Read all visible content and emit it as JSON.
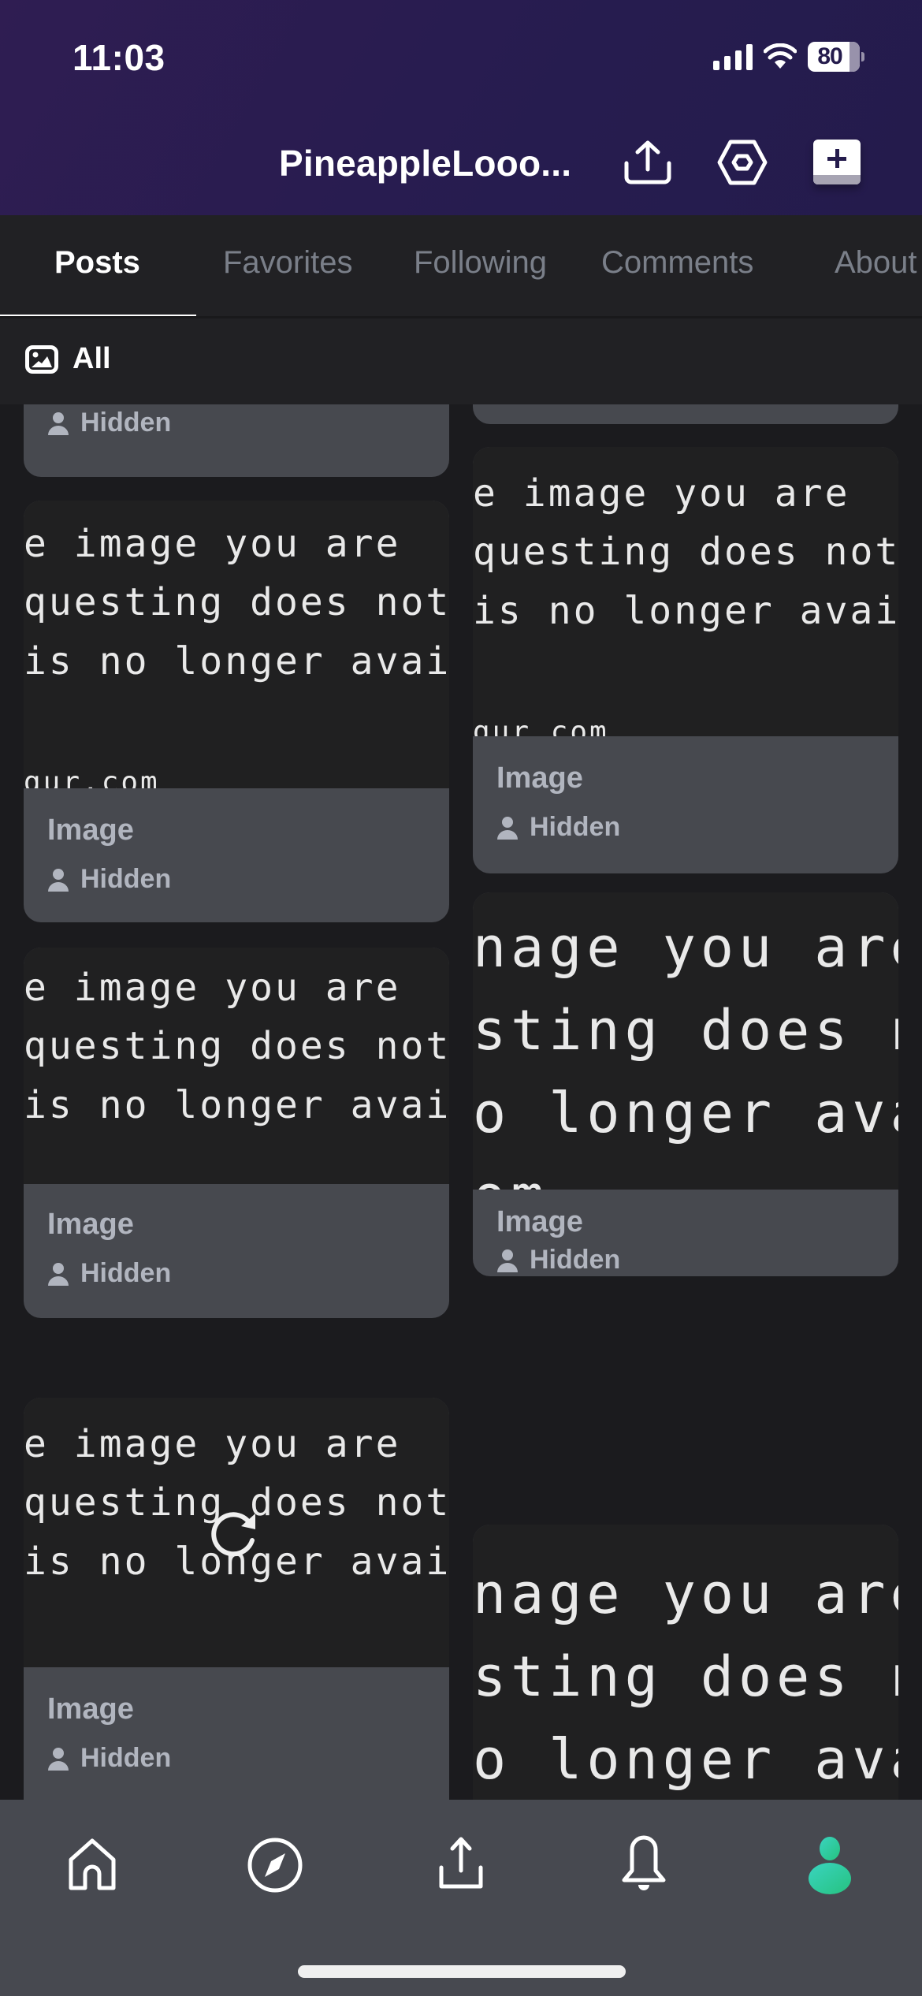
{
  "status_bar": {
    "time": "11:03",
    "battery_percent": "80",
    "signal_icon": "cellular-signal-icon",
    "wifi_icon": "wifi-icon"
  },
  "header": {
    "title": "PineappleLooo...",
    "actions": [
      {
        "name": "share-profile",
        "icon": "upload-icon"
      },
      {
        "name": "settings",
        "icon": "hexagon-gear-icon"
      },
      {
        "name": "new-post",
        "icon": "plus-icon"
      }
    ]
  },
  "tabs": [
    {
      "label": "Posts",
      "active": true
    },
    {
      "label": "Favorites",
      "active": false
    },
    {
      "label": "Following",
      "active": false
    },
    {
      "label": "Comments",
      "active": false
    },
    {
      "label": "About",
      "active": false
    }
  ],
  "filter": {
    "label": "All",
    "icon": "image-icon"
  },
  "image_placeholder_lines": [
    "e image you are",
    "questing does not exi",
    "is no longer availabl",
    "",
    "gur.com"
  ],
  "image_placeholder_lines_large": [
    "nage you are",
    "sting does nc",
    "o longer avai",
    "",
    "om"
  ],
  "posts": {
    "left": [
      {
        "title": "",
        "author": "Hidden",
        "partial": true
      },
      {
        "title": "Image",
        "author": "Hidden"
      },
      {
        "title": "Image",
        "author": "Hidden"
      },
      {
        "title": "Image",
        "author": "Hidden",
        "loading": true
      }
    ],
    "right": [
      {
        "title": "",
        "author": "",
        "partial": true
      },
      {
        "title": "Image",
        "author": "Hidden"
      },
      {
        "title": "Image",
        "author": "Hidden",
        "large": true
      },
      {
        "title": "",
        "author": "",
        "large": true,
        "partial": true
      }
    ]
  },
  "bottom_nav": [
    {
      "label": "Home",
      "icon": "home-icon",
      "active": false
    },
    {
      "label": "Explore",
      "icon": "compass-icon",
      "active": false
    },
    {
      "label": "Upload",
      "icon": "upload-icon",
      "active": false
    },
    {
      "label": "Notifications",
      "icon": "bell-icon",
      "active": false
    },
    {
      "label": "Profile",
      "icon": "profile-icon",
      "active": true
    }
  ],
  "colors": {
    "header_bg": "#261c4f",
    "surface": "#212124",
    "card_footer": "#47494f",
    "muted_text": "#7a7f89",
    "accent": "#2fd39a"
  }
}
